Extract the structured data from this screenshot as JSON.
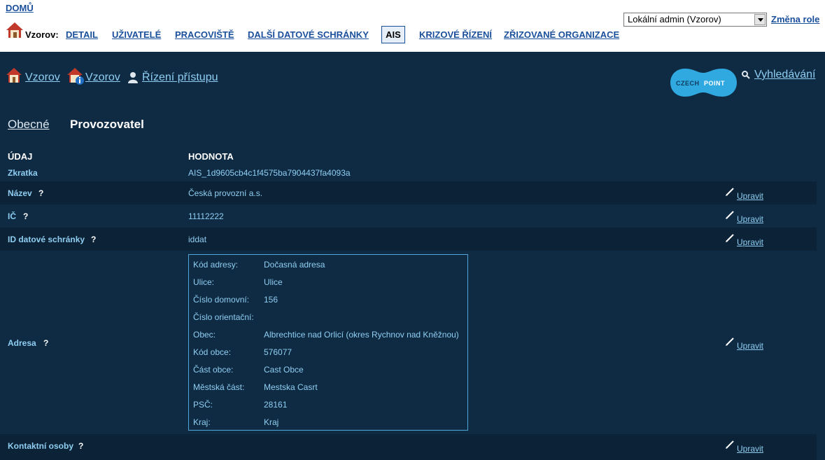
{
  "header": {
    "home": "DOMŮ",
    "org_label": "Vzorov:",
    "nav": [
      "DETAIL",
      "UŽIVATELÉ",
      "PRACOVIŠTĚ",
      "DALŠÍ DATOVÉ SCHRÁNKY"
    ],
    "nav_active": "AIS",
    "nav_after": [
      "KRIZOVÉ ŘÍZENÍ",
      "ZŘIZOVANÉ ORGANIZACE"
    ],
    "role_selected": "Lokální admin (Vzorov)",
    "change_role": "Změna role"
  },
  "breadcrumbs": [
    "Vzorov",
    "Vzorov",
    "Řízení přístupu"
  ],
  "logo_text": {
    "a": "CZECH",
    "b": "POINT"
  },
  "search": "Vyhledávání",
  "tabs": {
    "general": "Obecné",
    "operator": "Provozovatel"
  },
  "table": {
    "col_field": "ÚDAJ",
    "col_value": "HODNOTA",
    "help": "?",
    "edit": "Upravit",
    "rows": {
      "abbr": {
        "label": "Zkratka",
        "value": "AIS_1d9605cb4c1f4575ba7904437fa4093a"
      },
      "name": {
        "label": "Název",
        "value": "Česká provozní a.s."
      },
      "ic": {
        "label": "IČ",
        "value": "11112222"
      },
      "dbox": {
        "label": "ID datové schránky",
        "value": "iddat"
      },
      "address": {
        "label": "Adresa"
      },
      "contacts": {
        "label": "Kontaktní osoby"
      }
    },
    "address": [
      {
        "k": "Kód adresy:",
        "v": "Dočasná adresa"
      },
      {
        "k": "Ulice:",
        "v": "Ulice"
      },
      {
        "k": "Číslo domovní:",
        "v": "156"
      },
      {
        "k": "Číslo orientační:",
        "v": ""
      },
      {
        "k": "Obec:",
        "v": "Albrechtice nad Orlicí (okres Rychnov nad Kněžnou)"
      },
      {
        "k": "Kód obce:",
        "v": "576077"
      },
      {
        "k": "Část obce:",
        "v": "Cast Obce"
      },
      {
        "k": "Městská část:",
        "v": "Mestska Casrt"
      },
      {
        "k": "PSČ:",
        "v": "28161"
      },
      {
        "k": "Kraj:",
        "v": "Kraj"
      }
    ]
  },
  "colors": {
    "background": "#0f2b44",
    "accent": "#8fcef2",
    "link": "#1a4f9c",
    "logo": "#2fa9e0"
  }
}
